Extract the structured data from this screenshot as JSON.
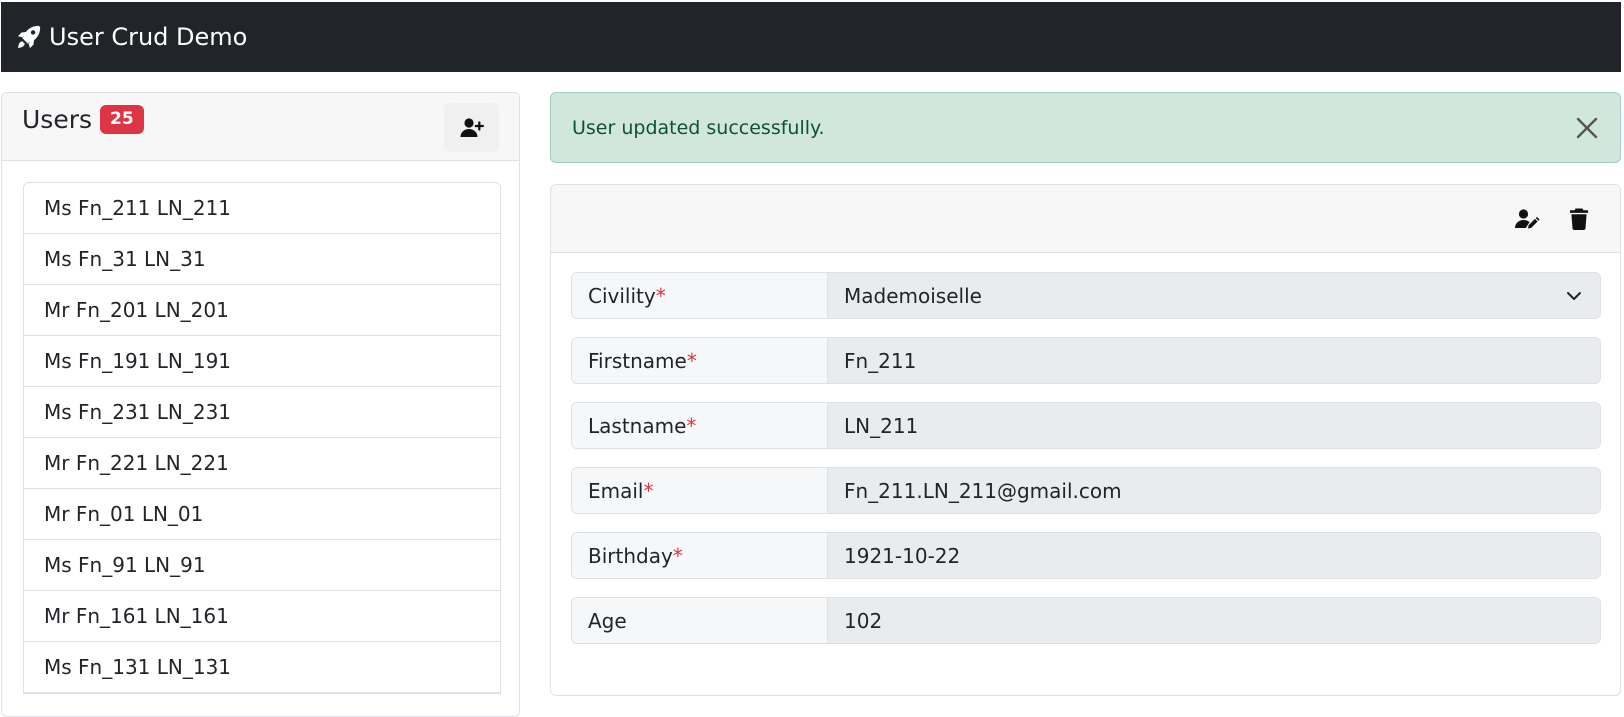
{
  "app": {
    "title": "User Crud Demo",
    "brand_icon": "rocket-icon"
  },
  "users_panel": {
    "title": "Users",
    "count": "25",
    "add_icon": "add-user-icon",
    "items": [
      {
        "label": "Ms Fn_211 LN_211"
      },
      {
        "label": "Ms Fn_31 LN_31"
      },
      {
        "label": "Mr Fn_201 LN_201"
      },
      {
        "label": "Ms Fn_191 LN_191"
      },
      {
        "label": "Ms Fn_231 LN_231"
      },
      {
        "label": "Mr Fn_221 LN_221"
      },
      {
        "label": "Mr Fn_01 LN_01"
      },
      {
        "label": "Ms Fn_91 LN_91"
      },
      {
        "label": "Mr Fn_161 LN_161"
      },
      {
        "label": "Ms Fn_131 LN_131"
      }
    ]
  },
  "alert": {
    "message": "User updated successfully.",
    "close_icon": "close-icon"
  },
  "detail": {
    "edit_icon": "edit-user-icon",
    "delete_icon": "trash-icon",
    "fields": {
      "civility": {
        "label": "Civility",
        "value": "Mademoiselle",
        "required": true
      },
      "firstname": {
        "label": "Firstname",
        "value": "Fn_211",
        "required": true
      },
      "lastname": {
        "label": "Lastname",
        "value": "LN_211",
        "required": true
      },
      "email": {
        "label": "Email",
        "value": "Fn_211.LN_211@gmail.com",
        "required": true
      },
      "birthday": {
        "label": "Birthday",
        "value": "1921-10-22",
        "required": true
      },
      "age": {
        "label": "Age",
        "value": "102",
        "required": false
      }
    },
    "required_marker": "*"
  },
  "colors": {
    "navbar": "#212529",
    "badge": "#dc3545",
    "alert_bg": "#d1e7dd",
    "alert_text": "#0f5132",
    "required": "#dc3545"
  }
}
